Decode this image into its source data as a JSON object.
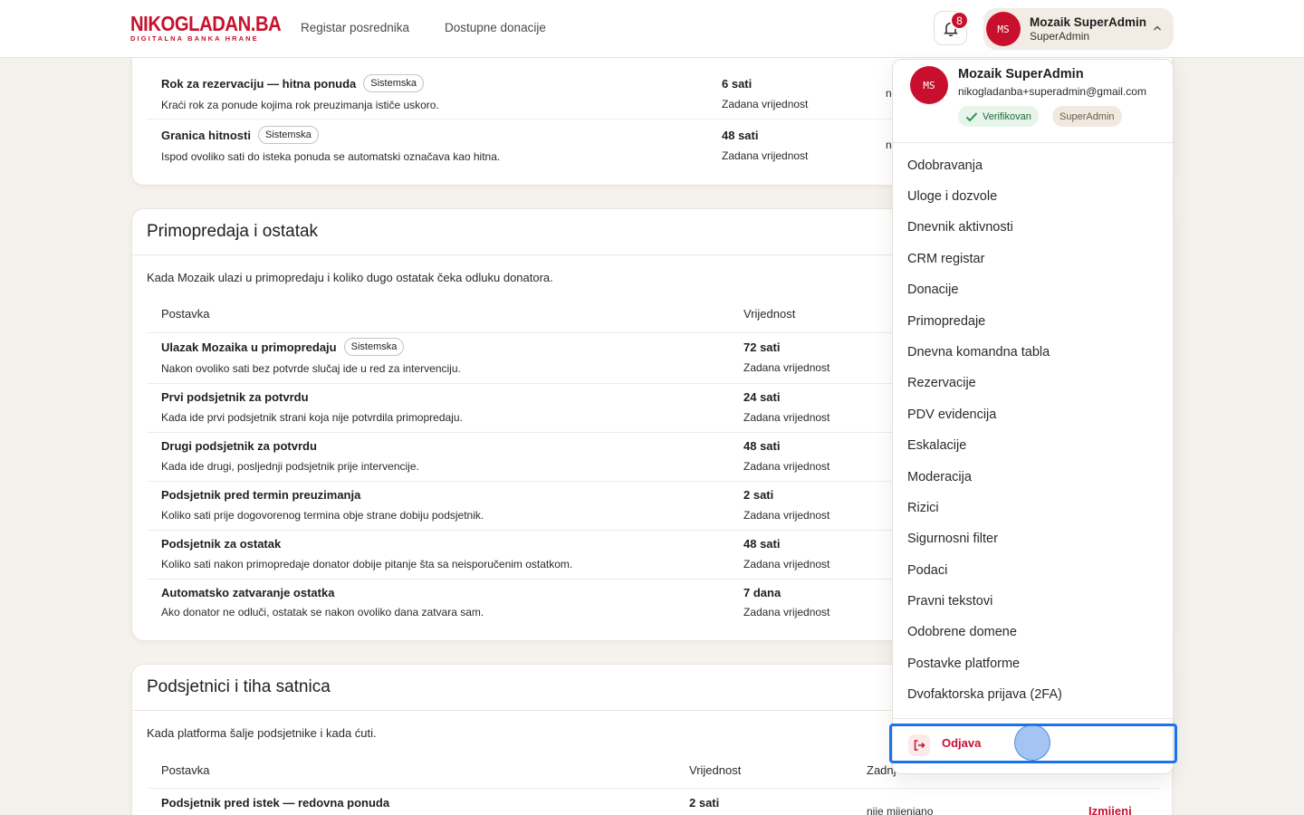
{
  "header": {
    "logo_main": "NIKOGLADAN.BA",
    "logo_sub": "DIGITALNA BANKA HRANE",
    "nav": [
      "Registar posrednika",
      "Dostupne donacije"
    ],
    "notification_count": "8",
    "user_initials": "MS",
    "user_name": "Mozaik SuperAdmin",
    "user_role": "SuperAdmin"
  },
  "card1": {
    "rows": [
      {
        "name": "Rok za rezervaciju — hitna ponuda",
        "tag": "Sistemska",
        "desc": "Kraći rok za ponude kojima rok preuzimanja ističe uskoro.",
        "value": "6 sati",
        "sub": "Zadana vrijednost",
        "clip": "n"
      },
      {
        "name": "Granica hitnosti",
        "tag": "Sistemska",
        "desc": "Ispod ovoliko sati do isteka ponuda se automatski označava kao hitna.",
        "value": "48 sati",
        "sub": "Zadana vrijednost",
        "clip": "n"
      }
    ]
  },
  "card2": {
    "title": "Primopredaja i ostatak",
    "desc": "Kada Mozaik ulazi u primopredaju i koliko dugo ostatak čeka odluku donatora.",
    "col_setting": "Postavka",
    "col_value": "Vrijednost",
    "rows": [
      {
        "name": "Ulazak Mozaika u primopredaju",
        "tag": "Sistemska",
        "desc": "Nakon ovoliko sati bez potvrde slučaj ide u red za intervenciju.",
        "value": "72 sati",
        "sub": "Zadana vrijednost"
      },
      {
        "name": "Prvi podsjetnik za potvrdu",
        "desc": "Kada ide prvi podsjetnik strani koja nije potvrdila primopredaju.",
        "value": "24 sati",
        "sub": "Zadana vrijednost"
      },
      {
        "name": "Drugi podsjetnik za potvrdu",
        "desc": "Kada ide drugi, posljednji podsjetnik prije intervencije.",
        "value": "48 sati",
        "sub": "Zadana vrijednost"
      },
      {
        "name": "Podsjetnik pred termin preuzimanja",
        "desc": "Koliko sati prije dogovorenog termina obje strane dobiju podsjetnik.",
        "value": "2 sati",
        "sub": "Zadana vrijednost"
      },
      {
        "name": "Podsjetnik za ostatak",
        "desc": "Koliko sati nakon primopredaje donator dobije pitanje šta sa neisporučenim ostatkom.",
        "value": "48 sati",
        "sub": "Zadana vrijednost"
      },
      {
        "name": "Automatsko zatvaranje ostatka",
        "desc": "Ako donator ne odluči, ostatak se nakon ovoliko dana zatvara sam.",
        "value": "7 dana",
        "sub": "Zadana vrijednost"
      }
    ]
  },
  "card3": {
    "title": "Podsjetnici i tiha satnica",
    "desc": "Kada platforma šalje podsjetnike i kada ćuti.",
    "col_setting": "Postavka",
    "col_value": "Vrijednost",
    "col_last": "Zadnj",
    "rows": [
      {
        "name": "Podsjetnik pred istek — redovna ponuda",
        "value": "2 sati",
        "last": "nije mijenjano",
        "edit": "Izmijeni"
      }
    ]
  },
  "dropdown": {
    "initials": "MS",
    "name": "Mozaik SuperAdmin",
    "email": "nikogladanba+superadmin@gmail.com",
    "verified": "Verifikovan",
    "role": "SuperAdmin",
    "items": [
      "Odobravanja",
      "Uloge i dozvole",
      "Dnevnik aktivnosti",
      "CRM registar",
      "Donacije",
      "Primopredaje",
      "Dnevna komandna tabla",
      "Rezervacije",
      "PDV evidencija",
      "Eskalacije",
      "Moderacija",
      "Rizici",
      "Sigurnosni filter",
      "Podaci",
      "Pravni tekstovi",
      "Odobrene domene",
      "Postavke platforme",
      "Dvofaktorska prijava (2FA)"
    ],
    "logout": "Odjava"
  },
  "colors": {
    "brand": "#c8102e",
    "focus": "#1a73e8"
  },
  "icons": {
    "bell": "bell-icon",
    "chevron": "chevron-up-icon",
    "check": "check-icon",
    "logout": "logout-icon"
  }
}
